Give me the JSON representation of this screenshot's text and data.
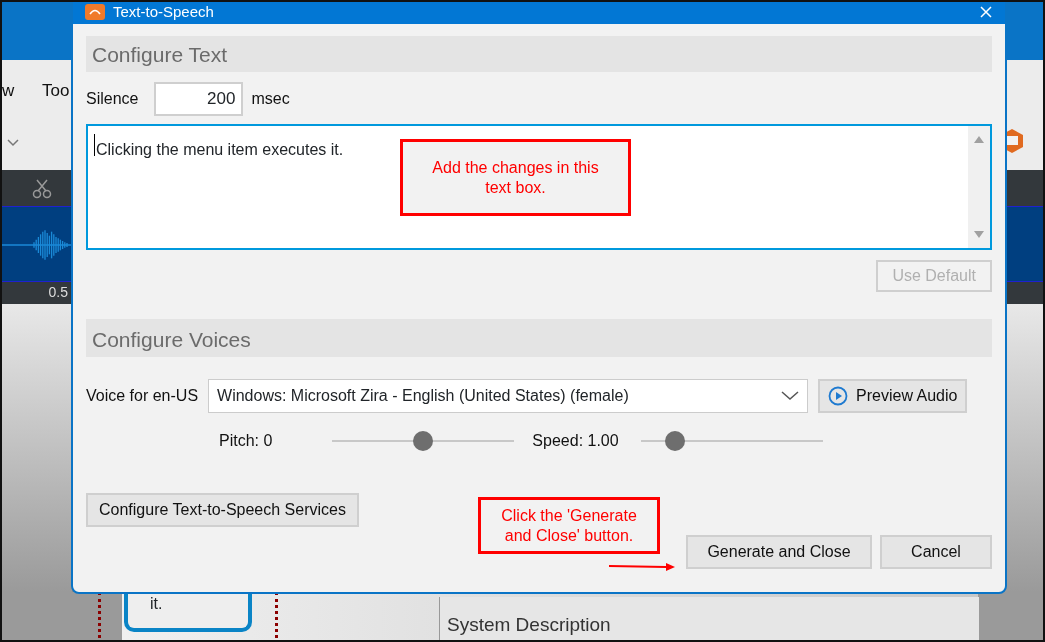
{
  "background_app": {
    "menu_items": [
      "w",
      "Too"
    ],
    "ruler_label": "0.5",
    "card_text": "it.",
    "table_header": "System Description"
  },
  "dialog": {
    "title": "Text-to-Speech",
    "text_section": {
      "heading": "Configure Text",
      "silence_label": "Silence",
      "silence_value": "200",
      "silence_unit": "msec",
      "text": "Clicking the menu item executes it.",
      "use_default": {
        "label": "Use Default",
        "disabled": true
      }
    },
    "voice_section": {
      "heading": "Configure Voices",
      "voice_label": "Voice for en-US",
      "voice_value": "Windows: Microsoft Zira - English (United States) (female)",
      "preview_button": "Preview Audio",
      "sliders": [
        {
          "label": "Pitch: 0",
          "level": 0.5
        },
        {
          "label": "Speed: 1.00",
          "level": 0.19
        }
      ]
    },
    "configure_services_button": "Configure Text-to-Speech Services",
    "buttons": [
      {
        "label": "Generate and Close"
      },
      {
        "label": "Cancel"
      }
    ]
  },
  "annotations": [
    {
      "kind": "callout",
      "text": "Add the changes in this text box."
    },
    {
      "kind": "callout",
      "text": "Click the 'Generate and Close' button."
    },
    {
      "kind": "arrow"
    }
  ]
}
